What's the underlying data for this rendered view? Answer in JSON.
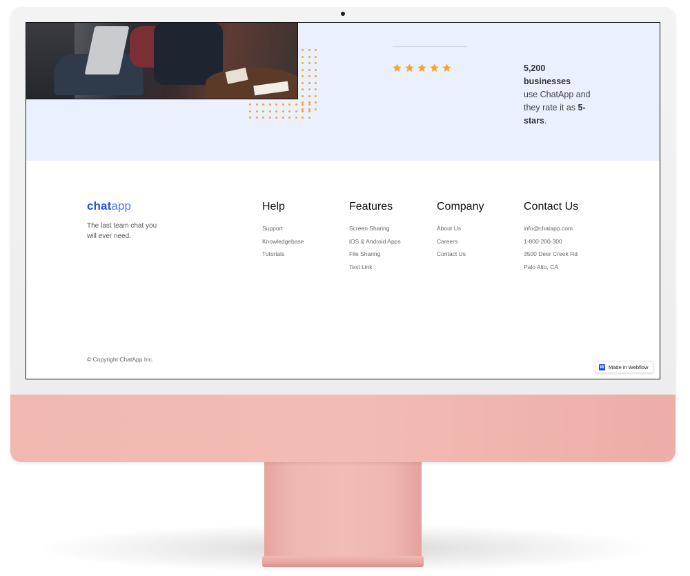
{
  "hero": {
    "rating": {
      "stars": 5,
      "star_color": "#f5a623",
      "line1_bold": "5,200 businesses",
      "line2": "use ChatApp and",
      "line3_pre": "they rate it as ",
      "line3_bold": "5-",
      "line4_bold": "stars",
      "line4_post": "."
    }
  },
  "footer": {
    "brand": {
      "logo_part1": "chat",
      "logo_part2": "app",
      "tagline": "The last team chat you will ever need."
    },
    "columns": [
      {
        "title": "Help",
        "items": [
          "Support",
          "Knowledgebase",
          "Tutorials"
        ]
      },
      {
        "title": "Features",
        "items": [
          "Screen Sharing",
          "iOS & Android Apps",
          "File Sharing",
          "Text Link"
        ]
      },
      {
        "title": "Company",
        "items": [
          "About Us",
          "Careers",
          "Contact Us"
        ]
      },
      {
        "title": "Contact Us",
        "items": [
          "info@chatapp.com",
          "1-800-200-300",
          "3500 Deer Creek Rd",
          "Palo Alto, CA"
        ]
      }
    ],
    "copyright": "© Copyright ChatApp Inc.",
    "badge": {
      "label": "Made in Webflow",
      "icon": "webflow-icon",
      "icon_glyph": "W"
    }
  },
  "colors": {
    "brand_blue": "#2552e0",
    "hero_bg": "#eaf0fe",
    "monitor_chin": "#f0b8b1"
  }
}
